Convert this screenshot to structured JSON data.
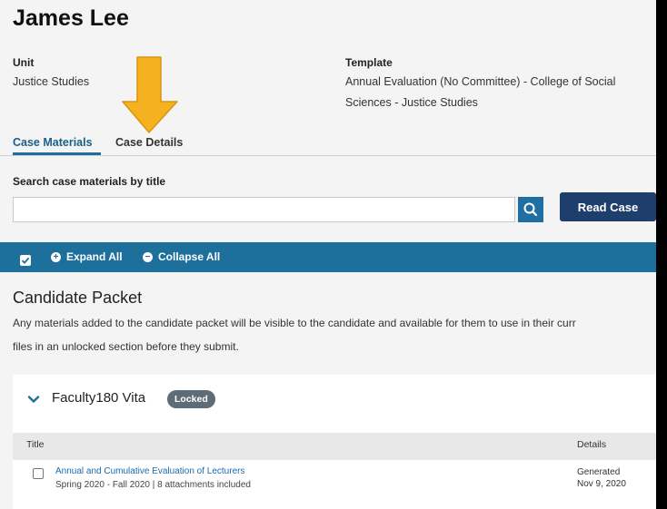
{
  "candidate_name": "James Lee",
  "meta": {
    "unit_label": "Unit",
    "unit_value": "Justice Studies",
    "template_label": "Template",
    "template_value": "Annual Evaluation (No Committee) - College of Social Sciences - Justice Studies"
  },
  "tabs": [
    {
      "label": "Case Materials",
      "active": true
    },
    {
      "label": "Case Details",
      "active": false
    }
  ],
  "search": {
    "label": "Search case materials by title",
    "value": "",
    "placeholder": "",
    "icon": "search-icon"
  },
  "read_case_label": "Read Case",
  "toolbar": {
    "expand_all": "Expand All",
    "collapse_all": "Collapse All"
  },
  "packet": {
    "title": "Candidate Packet",
    "description_line1": "Any materials added to the candidate packet will be visible to the candidate and available for them to use in their curr",
    "description_line2": "files in an unlocked section before they submit."
  },
  "section": {
    "title": "Faculty180 Vita",
    "badge": "Locked",
    "columns": [
      "Title",
      "Details"
    ],
    "rows": [
      {
        "title": "Annual and Cumulative Evaluation of Lecturers",
        "subtitle": "Spring 2020 - Fall 2020 | 8 attachments included",
        "details_line1": "Generated",
        "details_line2": "Nov 9, 2020"
      }
    ]
  },
  "colors": {
    "toolbar": "#1d6f9c",
    "read_case": "#1e3e6b",
    "link": "#1a6bb0",
    "badge": "#5e6c78",
    "annotation_arrow": "#f5b11f"
  }
}
